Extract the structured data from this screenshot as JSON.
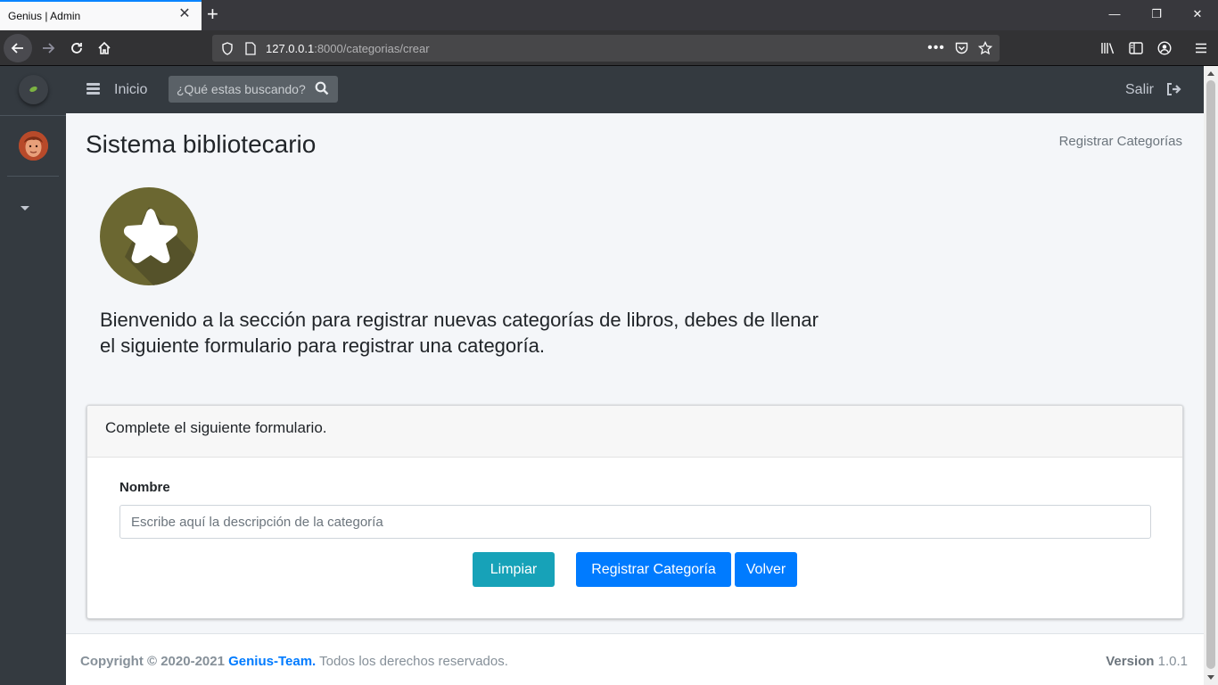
{
  "browser": {
    "tab_title": "Genius | Admin",
    "url_host": "127.0.0.1",
    "url_rest": ":8000/categorias/crear"
  },
  "topnav": {
    "home_label": "Inicio",
    "search_placeholder": "¿Qué estas buscando?",
    "logout_label": "Salir"
  },
  "header": {
    "title": "Sistema bibliotecario",
    "breadcrumb": "Registrar Categorías"
  },
  "welcome_text": "Bienvenido a la sección para registrar nuevas categorías de libros, debes de llenar el siguiente formulario para registrar una categoría.",
  "form": {
    "card_title": "Complete el siguiente formulario.",
    "name_label": "Nombre",
    "name_placeholder": "Escribe aquí la descripción de la categoría",
    "name_value": "",
    "clear_button": "Limpiar",
    "submit_button": "Registrar Categoría",
    "back_button": "Volver"
  },
  "footer": {
    "copyright_prefix": "Copyright © 2020-2021",
    "team_name": "Genius-Team.",
    "rights": "Todos los derechos reservados.",
    "version_label": "Version",
    "version_value": "1.0.1"
  },
  "colors": {
    "accent": "#007bff",
    "info": "#17a2b8",
    "sidebar": "#343a40"
  }
}
